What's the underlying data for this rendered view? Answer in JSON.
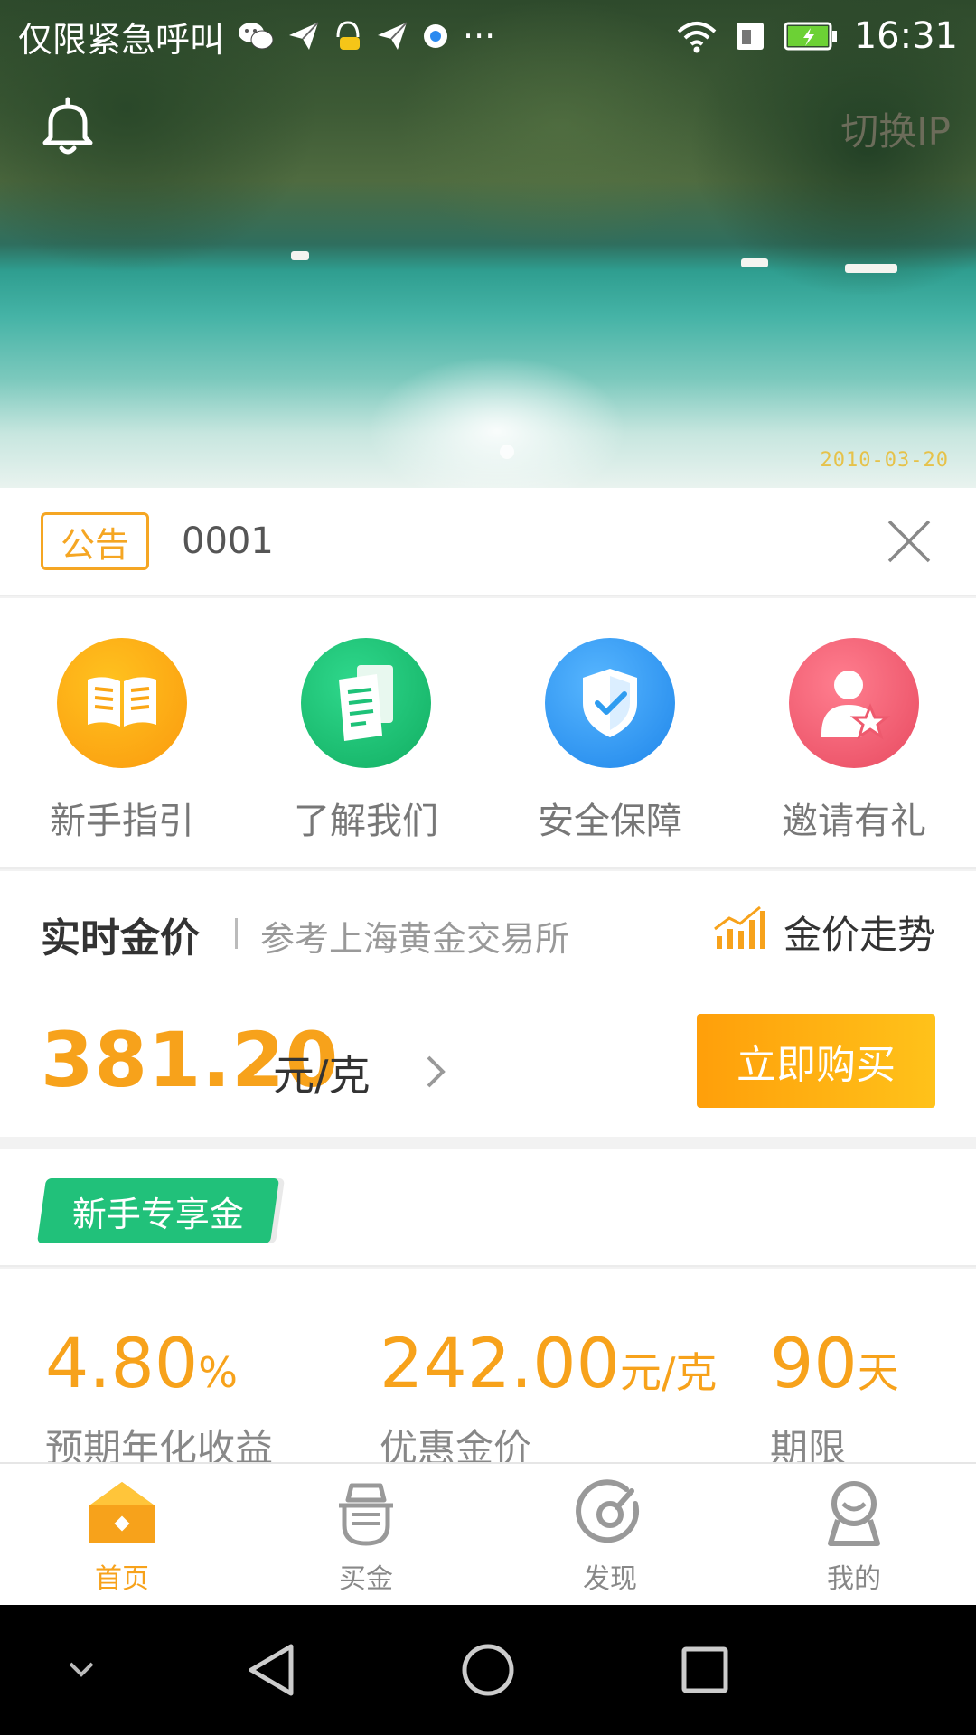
{
  "status_bar": {
    "carrier": "仅限紧急呼叫",
    "time": "16:31",
    "more": "···"
  },
  "hero": {
    "datestamp": "2010-03-20",
    "switch_ip_label": "切换IP"
  },
  "notice": {
    "tag": "公告",
    "text": "0001"
  },
  "menu": {
    "items": [
      {
        "label": "新手指引",
        "icon": "book-icon",
        "color": "#fba614"
      },
      {
        "label": "了解我们",
        "icon": "document-icon",
        "color": "#1ec278"
      },
      {
        "label": "安全保障",
        "icon": "shield-icon",
        "color": "#2e9cf0"
      },
      {
        "label": "邀请有礼",
        "icon": "user-star-icon",
        "color": "#ee5a6e"
      }
    ]
  },
  "gold_price": {
    "title": "实时金价",
    "reference": "参考上海黄金交易所",
    "trend_label": "金价走势",
    "value": "381.20",
    "unit": "元/克",
    "buy_label": "立即购买"
  },
  "newbie": {
    "badge": "新手专享金",
    "stats": [
      {
        "value": "4.80",
        "suffix": "%",
        "caption": "预期年化收益"
      },
      {
        "value": "242.00",
        "suffix": "元/克",
        "caption": "优惠金价"
      },
      {
        "value": "90",
        "suffix": "天",
        "caption": "期限"
      }
    ]
  },
  "tabs": [
    {
      "label": "首页",
      "icon": "home-icon",
      "active": true
    },
    {
      "label": "买金",
      "icon": "buy-gold-icon",
      "active": false
    },
    {
      "label": "发现",
      "icon": "discover-icon",
      "active": false
    },
    {
      "label": "我的",
      "icon": "profile-icon",
      "active": false
    }
  ],
  "colors": {
    "accent": "#f7a21b",
    "green": "#21c17a",
    "text_muted": "#888888"
  }
}
